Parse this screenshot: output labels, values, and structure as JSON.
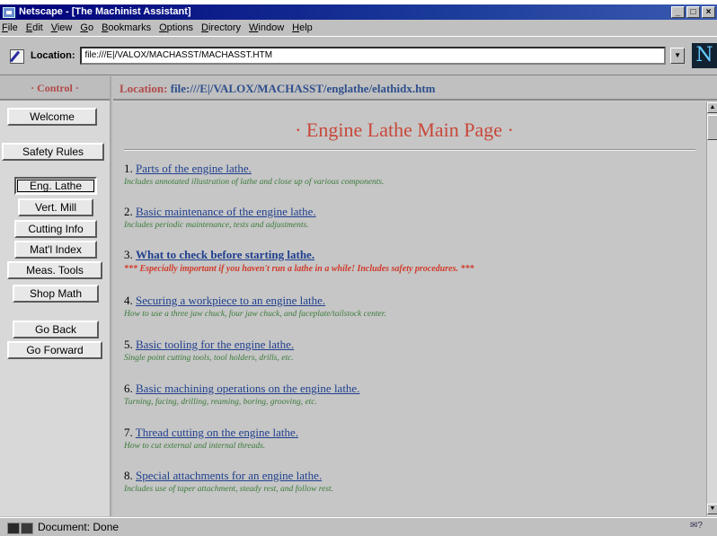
{
  "window": {
    "title": "Netscape - [The Machinist Assistant]",
    "controls": [
      "_",
      "□",
      "×"
    ]
  },
  "menu": [
    "File",
    "Edit",
    "View",
    "Go",
    "Bookmarks",
    "Options",
    "Directory",
    "Window",
    "Help"
  ],
  "location_bar": {
    "label": "Location:",
    "value": "file:///E|/VALOX/MACHASST/MACHASST.HTM"
  },
  "left_frame": {
    "header": "· Control ·",
    "buttons": [
      "Welcome",
      "Safety Rules",
      "Eng. Lathe",
      "Vert. Mill",
      "Cutting Info",
      "Mat'l Index",
      "Meas. Tools",
      "Shop Math",
      "Go Back",
      "Go Forward"
    ],
    "active": "Eng. Lathe"
  },
  "right_frame": {
    "location_label": "Location:",
    "location_url": "file:///E|/VALOX/MACHASST/englathe/elathidx.htm",
    "page_title": "· Engine Lathe Main Page ·",
    "items": [
      {
        "num": "1.",
        "link": "Parts of the engine lathe.",
        "desc": "Includes annotated illustration of lathe and close up of various components."
      },
      {
        "num": "2.",
        "link": "Basic maintenance of the engine lathe.",
        "desc": "Includes periodic maintenance, tests and adjustments."
      },
      {
        "num": "3.",
        "link": "What to check before starting lathe.",
        "desc": "*** Especially important if you haven't run a lathe in a while! Includes safety procedures. ***"
      },
      {
        "num": "4.",
        "link": "Securing a workpiece to an engine lathe.",
        "desc": "How to use a three jaw chuck, four jaw chuck, and faceplate/tailstock center."
      },
      {
        "num": "5.",
        "link": "Basic tooling for the engine lathe.",
        "desc": "Single point cutting tools, tool holders, drills, etc."
      },
      {
        "num": "6.",
        "link": "Basic machining operations on the engine lathe.",
        "desc": "Turning, facing, drilling, reaming, boring, grooving, etc."
      },
      {
        "num": "7.",
        "link": "Thread cutting on the engine lathe.",
        "desc": "How to cut external and internal threads."
      },
      {
        "num": "8.",
        "link": "Special attachments for an engine lathe.",
        "desc": "Includes use of taper attachment, steady rest, and follow rest."
      }
    ]
  },
  "status": {
    "text": "Document: Done"
  },
  "colors": {
    "title_accent": "#c8483a",
    "link": "#1f3f8e",
    "desc": "#3a7a3a",
    "warning": "#d03a2a"
  }
}
